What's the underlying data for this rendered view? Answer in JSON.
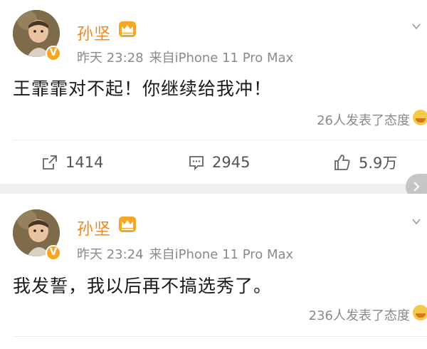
{
  "posts": [
    {
      "author": "孙坚",
      "time": "昨天 23:28",
      "source": "来自iPhone 11 Pro Max",
      "content": "王霏霏对不起！你继续给我冲！",
      "reactions": "26人发表了态度",
      "repost_count": "1414",
      "comment_count": "2945",
      "like_count": "5.9万"
    },
    {
      "author": "孙坚",
      "time": "昨天 23:24",
      "source": "来自iPhone 11 Pro Max",
      "content": "我发誓，我以后再不搞选秀了。",
      "reactions": "236人发表了态度"
    }
  ],
  "verified_badge": "V",
  "colors": {
    "name": "#f08a1d",
    "meta": "#8a8a8a",
    "badge": "#f5a623",
    "separator": "#efefef"
  },
  "icons": [
    "crown-icon",
    "verified-badge-icon",
    "repost-icon",
    "comment-icon",
    "like-icon",
    "chevron-down-icon",
    "emoji-icon",
    "arrow-right-icon"
  ]
}
